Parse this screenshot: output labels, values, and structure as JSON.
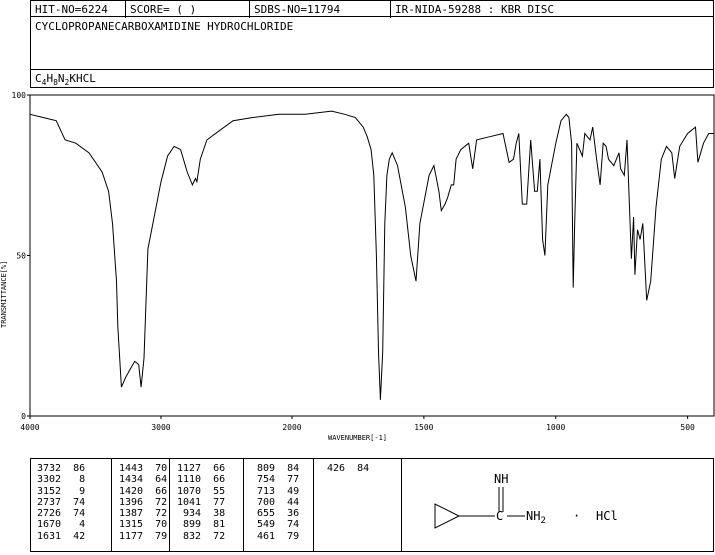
{
  "header": {
    "hit_no": "HIT-NO=6224",
    "score": "SCORE=  (   )",
    "sdbs_no": "SDBS-NO=11794",
    "ir_info": "IR-NIDA-59288 : KBR DISC",
    "compound_name": "CYCLOPROPANECARBOXAMIDINE HYDROCHLORIDE",
    "formula_c": "C",
    "formula_c_n": "4",
    "formula_h": "H",
    "formula_h_n": "8",
    "formula_n": "N",
    "formula_n_n": "2",
    "formula_rest": "KHCL"
  },
  "chart_data": {
    "type": "line",
    "title": "",
    "xlabel": "WAVENUMBER[-1]",
    "ylabel": "TRANSMITTANCE[%]",
    "xlim": [
      4000,
      400
    ],
    "ylim": [
      0,
      100
    ],
    "x_ticks": [
      "4000",
      "3000",
      "2000",
      "1500",
      "1000",
      "500"
    ],
    "y_ticks": [
      "100",
      "50",
      "0"
    ],
    "series": [
      {
        "x": [
          4000,
          3900,
          3800,
          3732,
          3650,
          3550,
          3450,
          3400,
          3370,
          3340,
          3330,
          3302,
          3270,
          3230,
          3200,
          3170,
          3152,
          3130,
          3100,
          3000,
          2950,
          2900,
          2850,
          2800,
          2760,
          2737,
          2726,
          2700,
          2650,
          2550,
          2450,
          2300,
          2100,
          1950,
          1850,
          1800,
          1760,
          1730,
          1715,
          1700,
          1690,
          1680,
          1672,
          1665,
          1656,
          1648,
          1640,
          1631,
          1620,
          1600,
          1570,
          1550,
          1530,
          1515,
          1480,
          1462,
          1443,
          1434,
          1420,
          1410,
          1396,
          1387,
          1378,
          1360,
          1330,
          1315,
          1300,
          1250,
          1200,
          1177,
          1160,
          1150,
          1140,
          1127,
          1110,
          1095,
          1080,
          1070,
          1060,
          1050,
          1041,
          1030,
          1000,
          980,
          960,
          950,
          940,
          934,
          928,
          920,
          899,
          890,
          870,
          860,
          845,
          832,
          820,
          809,
          800,
          780,
          760,
          754,
          740,
          730,
          713,
          705,
          700,
          690,
          680,
          670,
          655,
          640,
          620,
          600,
          580,
          560,
          549,
          530,
          500,
          470,
          461,
          440,
          420,
          400
        ],
        "values": [
          94,
          93,
          92,
          86,
          85,
          82,
          76,
          70,
          60,
          42,
          28,
          9,
          12,
          15,
          17,
          16,
          9,
          18,
          52,
          73,
          81,
          84,
          83,
          76,
          72,
          74,
          73,
          80,
          86,
          89,
          92,
          93,
          94,
          94,
          95,
          94,
          93,
          90,
          87,
          83,
          75,
          50,
          20,
          5,
          20,
          60,
          75,
          80,
          82,
          78,
          65,
          50,
          42,
          60,
          75,
          78,
          70,
          64,
          66,
          68,
          72,
          72,
          80,
          83,
          85,
          77,
          86,
          87,
          88,
          79,
          80,
          85,
          88,
          66,
          66,
          86,
          70,
          70,
          80,
          55,
          50,
          72,
          85,
          92,
          94,
          93,
          85,
          40,
          60,
          85,
          81,
          88,
          86,
          90,
          80,
          72,
          85,
          84,
          80,
          78,
          82,
          77,
          75,
          86,
          49,
          62,
          44,
          58,
          55,
          60,
          36,
          42,
          65,
          80,
          84,
          82,
          74,
          84,
          88,
          90,
          79,
          85,
          88,
          88
        ]
      }
    ]
  },
  "peaks": [
    {
      "wn": "3732",
      "t": "86"
    },
    {
      "wn": "3302",
      "t": "8"
    },
    {
      "wn": "3152",
      "t": "9"
    },
    {
      "wn": "2737",
      "t": "74"
    },
    {
      "wn": "2726",
      "t": "74"
    },
    {
      "wn": "1670",
      "t": "4"
    },
    {
      "wn": "1631",
      "t": "42"
    },
    {
      "wn": "1443",
      "t": "70"
    },
    {
      "wn": "1434",
      "t": "64"
    },
    {
      "wn": "1420",
      "t": "66"
    },
    {
      "wn": "1396",
      "t": "72"
    },
    {
      "wn": "1387",
      "t": "72"
    },
    {
      "wn": "1315",
      "t": "70"
    },
    {
      "wn": "1177",
      "t": "79"
    },
    {
      "wn": "1127",
      "t": "66"
    },
    {
      "wn": "1110",
      "t": "66"
    },
    {
      "wn": "1070",
      "t": "55"
    },
    {
      "wn": "1041",
      "t": "77"
    },
    {
      "wn": "934",
      "t": "38"
    },
    {
      "wn": "899",
      "t": "81"
    },
    {
      "wn": "832",
      "t": "72"
    },
    {
      "wn": "809",
      "t": "84"
    },
    {
      "wn": "754",
      "t": "77"
    },
    {
      "wn": "713",
      "t": "49"
    },
    {
      "wn": "700",
      "t": "44"
    },
    {
      "wn": "655",
      "t": "36"
    },
    {
      "wn": "549",
      "t": "74"
    },
    {
      "wn": "461",
      "t": "79"
    },
    {
      "wn": "426",
      "t": "84"
    }
  ],
  "structure": {
    "imine": "NH",
    "amine": "C",
    "amine_nh2": "NH",
    "amine_sub": "2",
    "dot": "·",
    "salt": "HCl"
  }
}
